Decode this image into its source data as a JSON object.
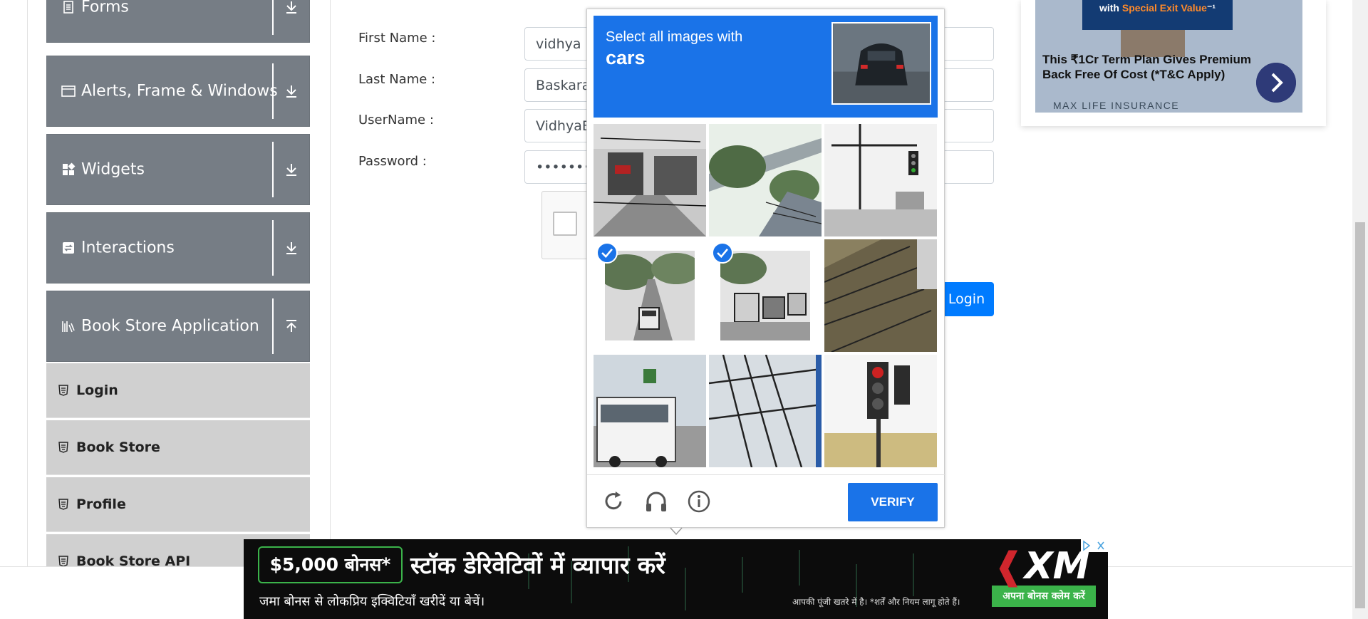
{
  "sidebar": {
    "groups": [
      {
        "label": "Forms",
        "icon": "document-icon",
        "arrow": "download-arrow-icon"
      },
      {
        "label": "Alerts, Frame & Windows",
        "icon": "window-icon",
        "arrow": "download-arrow-icon"
      },
      {
        "label": "Widgets",
        "icon": "widgets-icon",
        "arrow": "download-arrow-icon"
      },
      {
        "label": "Interactions",
        "icon": "interactions-icon",
        "arrow": "download-arrow-icon"
      },
      {
        "label": "Book Store Application",
        "icon": "books-icon",
        "arrow": "upload-arrow-icon"
      }
    ],
    "items": [
      {
        "label": "Login"
      },
      {
        "label": "Book Store"
      },
      {
        "label": "Profile"
      },
      {
        "label": "Book Store API"
      }
    ]
  },
  "form": {
    "first_name_label": "First Name :",
    "first_name_value": "vidhya",
    "last_name_label": "Last Name :",
    "last_name_value": "Baskaran",
    "username_label": "UserName :",
    "username_value": "VidhyaB",
    "password_label": "Password :",
    "password_value": "••••••••••",
    "login_button": "Login"
  },
  "captcha": {
    "instruction": "Select all images with",
    "target": "cars",
    "verify_label": "VERIFY",
    "tiles": [
      {
        "selected": false
      },
      {
        "selected": false
      },
      {
        "selected": false
      },
      {
        "selected": true
      },
      {
        "selected": true
      },
      {
        "selected": false
      },
      {
        "selected": false
      },
      {
        "selected": false
      },
      {
        "selected": false
      }
    ],
    "accent": "#1a73e8"
  },
  "right_ad": {
    "banner_text_prefix": "with ",
    "banner_text_highlight": "Special Exit Value",
    "banner_text_suffix": "⁻¹",
    "headline": "This ₹1Cr Term Plan Gives Premium Back Free Of Cost (*T&C Apply)",
    "brand": "MAX LIFE INSURANCE"
  },
  "bottom_ad": {
    "bonus": "$5,000 बोनस*",
    "headline": "स्टॉक डेरिवेटिवों में व्यापार करें",
    "sub": "जमा बोनस से लोकप्रिय इक्विटियाँ खरीदें या बेचें।",
    "disclaimer": "आपकी पूंजी खतरे में है। *शर्तें और नियम लागू होते हैं।",
    "cta": "अपना बोनस क्लेम करें",
    "logo_part1": "❰",
    "logo_part2": "XM"
  }
}
